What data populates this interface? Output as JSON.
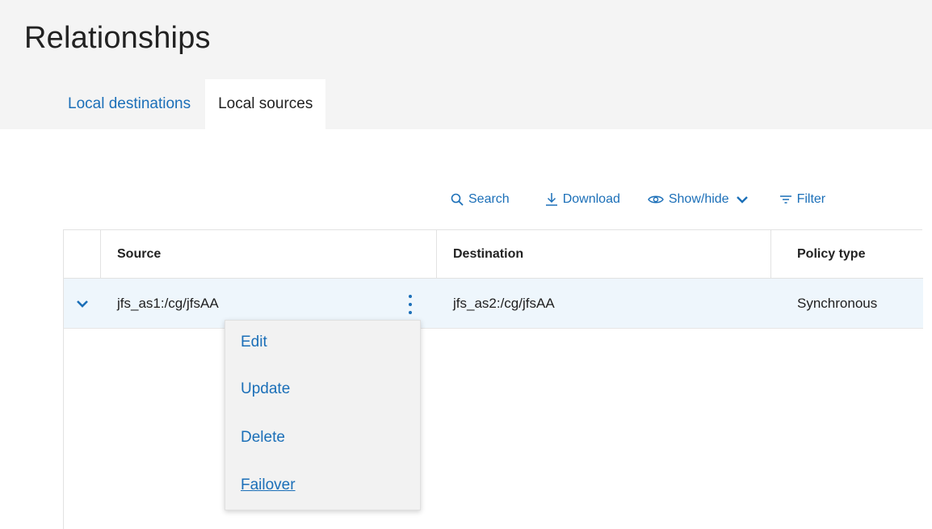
{
  "page": {
    "title": "Relationships"
  },
  "tabs": [
    {
      "label": "Local destinations",
      "active": false
    },
    {
      "label": "Local sources",
      "active": true
    }
  ],
  "toolbar": {
    "search_label": "Search",
    "download_label": "Download",
    "showhide_label": "Show/hide",
    "filter_label": "Filter"
  },
  "table": {
    "columns": [
      "Source",
      "Destination",
      "Policy type"
    ],
    "rows": [
      {
        "source": "jfs_as1:/cg/jfsAA",
        "destination": "jfs_as2:/cg/jfsAA",
        "policy_type": "Synchronous"
      }
    ]
  },
  "context_menu": {
    "items": [
      "Edit",
      "Update",
      "Delete",
      "Failover"
    ]
  },
  "colors": {
    "accent": "#1b6fb8",
    "row_selected": "#eef6fc",
    "background": "#f4f4f4"
  },
  "icons": [
    "search-icon",
    "download-icon",
    "eye-icon",
    "chevron-down-icon",
    "filter-icon",
    "kebab-icon"
  ]
}
